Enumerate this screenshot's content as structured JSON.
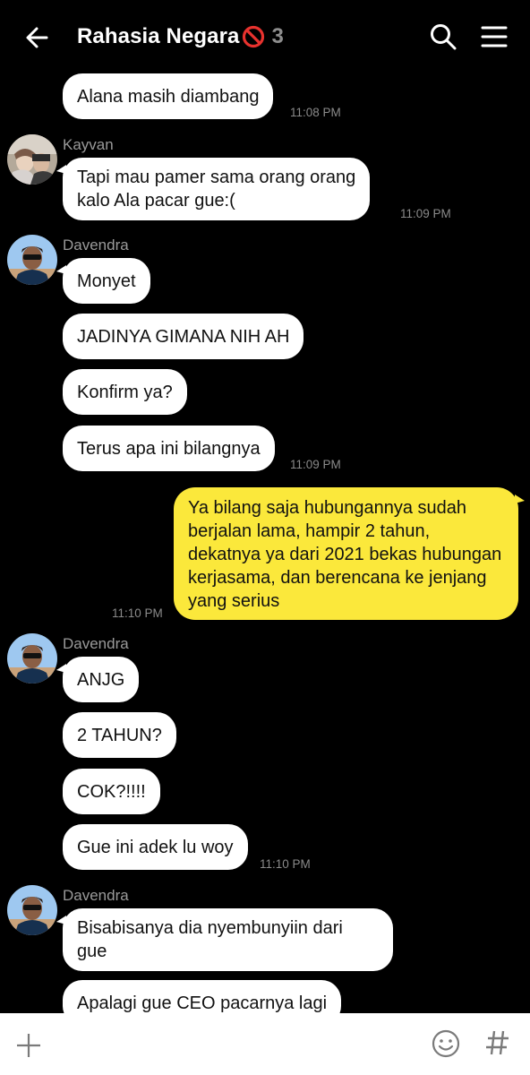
{
  "header": {
    "title": "Rahasia Negara",
    "member_count": "3",
    "icons": {
      "back": "arrow-left-icon",
      "search": "search-icon",
      "menu": "hamburger-menu-icon",
      "title_badge": "no-entry-emoji"
    }
  },
  "messages": [
    {
      "sender": "",
      "text": "Alana masih diambang",
      "time": "11:08 PM"
    },
    {
      "sender": "Kayvan",
      "text": [
        "Tapi mau pamer sama orang orang",
        "kalo Ala pacar gue:("
      ],
      "time": "11:09 PM"
    },
    {
      "sender": "Davendra",
      "group": [
        {
          "text": "Monyet"
        },
        {
          "text": "JADINYA GIMANA NIH AH"
        },
        {
          "text": "Konfirm ya?"
        },
        {
          "text": "Terus apa ini bilangnya",
          "time": "11:09 PM"
        }
      ]
    },
    {
      "sender": "me",
      "text": "Ya bilang saja hubungannya sudah berjalan lama, hampir 2 tahun, dekatnya ya dari 2021 bekas hubungan kerjasama, dan berencana ke jenjang yang serius",
      "time": "11:10 PM"
    },
    {
      "sender": "Davendra",
      "group": [
        {
          "text": "ANJG"
        },
        {
          "text": "2 TAHUN?"
        },
        {
          "text": "COK?!!!!"
        },
        {
          "text": "Gue ini adek lu woy",
          "time": "11:10 PM"
        }
      ]
    },
    {
      "sender": "Davendra",
      "group": [
        {
          "text": [
            "Bisabisanya dia nyembunyiin dari",
            "gue"
          ]
        },
        {
          "text": "Apalagi gue CEO pacarnya lagi"
        }
      ]
    }
  ],
  "input_bar": {
    "icons": {
      "attach": "plus-icon",
      "sticker": "emoji-smile-icon",
      "hashtag": "hashtag-icon"
    }
  },
  "colors": {
    "background": "#000000",
    "bubble_other": "#ffffff",
    "bubble_me": "#fbe83b",
    "timestamp": "#8a8a8a"
  }
}
